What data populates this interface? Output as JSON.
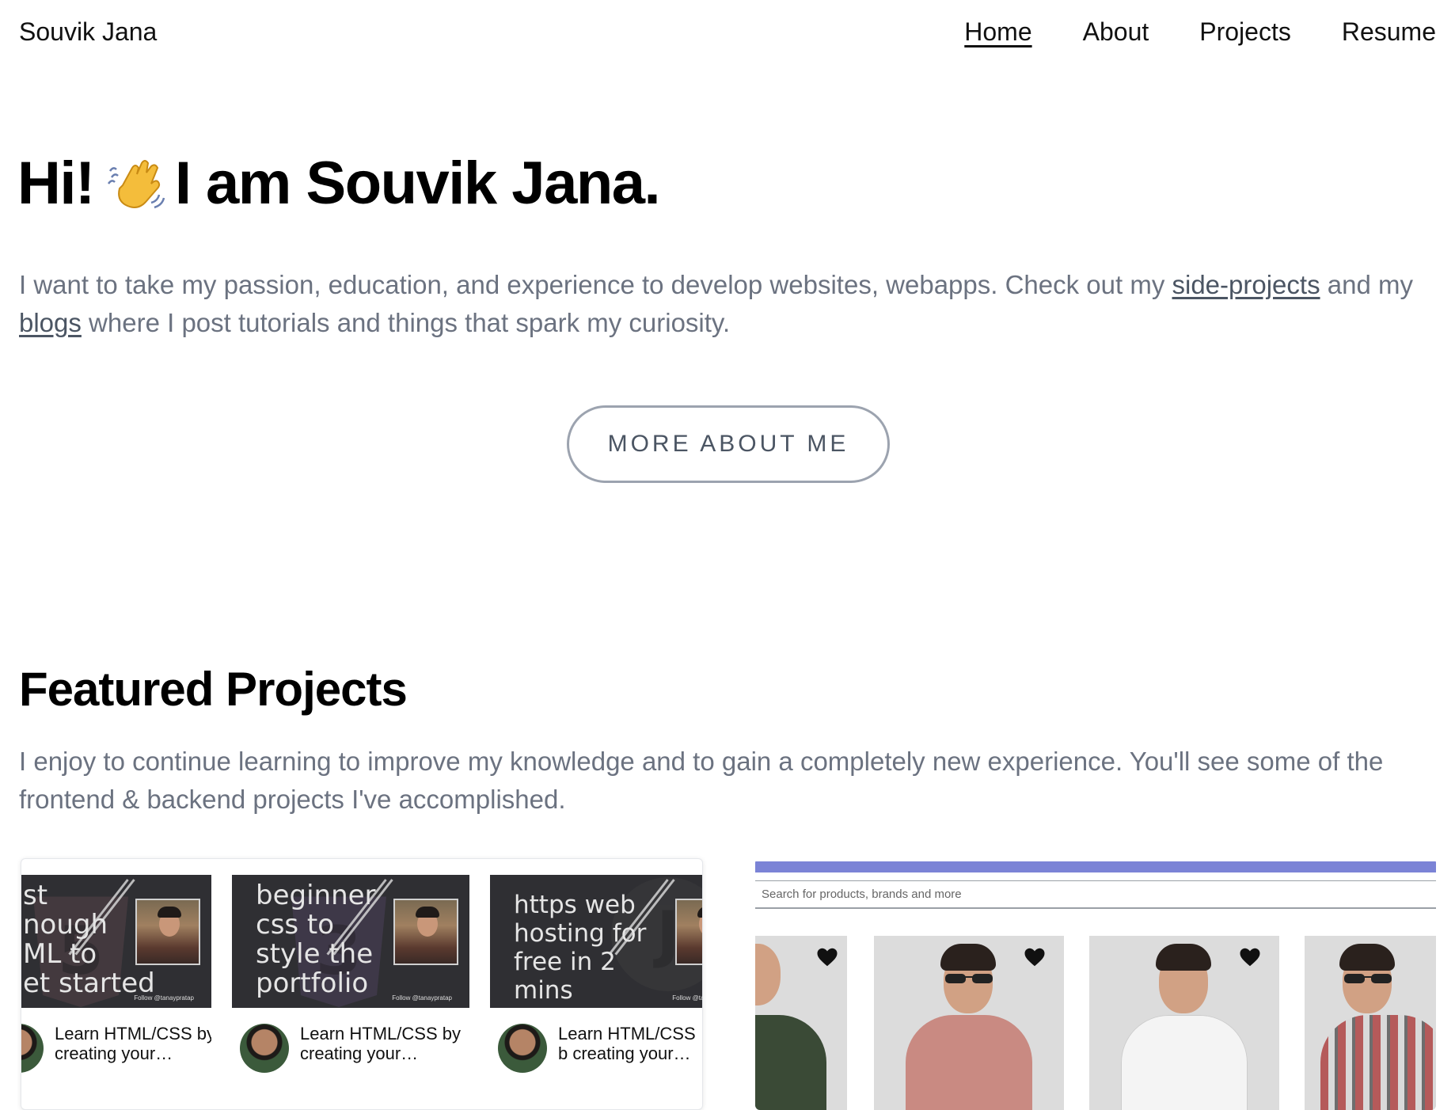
{
  "header": {
    "brand": "Souvik Jana",
    "nav": [
      {
        "label": "Home",
        "active": true
      },
      {
        "label": "About",
        "active": false
      },
      {
        "label": "Projects",
        "active": false
      },
      {
        "label": "Resume",
        "active": false
      }
    ]
  },
  "hero": {
    "greeting": "Hi!",
    "wave_icon": "waving-hand-emoji",
    "name_line": "I am Souvik Jana.",
    "text_before": "I want to take my passion, education, and experience to develop websites, webapps. Check out my ",
    "link_side_projects": "side-projects",
    "text_middle": " and my ",
    "link_blogs": "blogs",
    "text_after": " where I post tutorials and things that spark my curiosity.",
    "button": "MORE ABOUT ME"
  },
  "featured": {
    "title": "Featured Projects",
    "description": "I enjoy to continue learning to improve my knowledge and to gain a completely new experience. You'll see some of the frontend & backend projects I've accomplished."
  },
  "project_left": {
    "videos": [
      {
        "caption": "st\nnough\nML to\net started",
        "follow": "Follow @tanaypratap",
        "title": "Learn HTML/CSS by creating your…"
      },
      {
        "caption": "beginner\ncss to\nstyle the\nportfolio",
        "follow": "Follow @tanaypratap",
        "title": "Learn HTML/CSS by creating your…"
      },
      {
        "caption": "https web\nhosting for\nfree in 2\nmins",
        "follow": "Follow @tanaypratap",
        "title": "Learn HTML/CSS b creating your…"
      }
    ]
  },
  "project_right": {
    "search_placeholder": "Search for products, brands and more",
    "accent_color": "#7b83d6"
  }
}
